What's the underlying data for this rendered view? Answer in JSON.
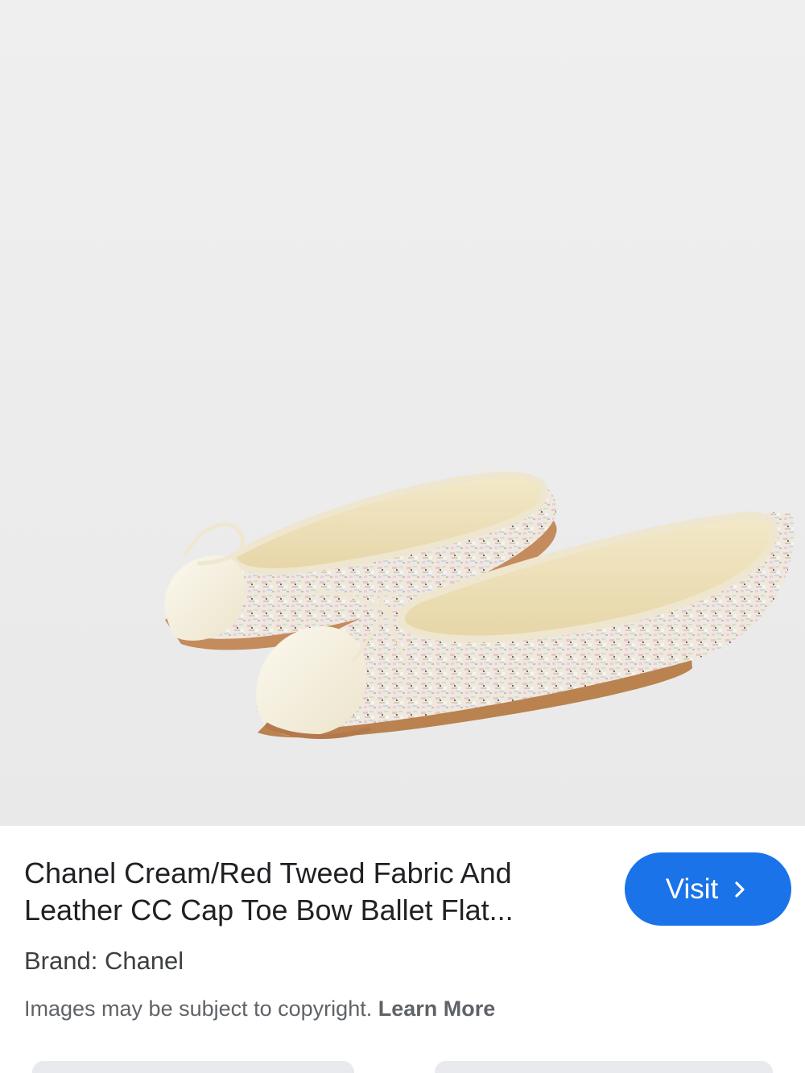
{
  "product": {
    "title": "Chanel Cream/Red Tweed Fabric And Leather CC Cap Toe Bow Ballet Flat...",
    "brand": "Brand: Chanel"
  },
  "actions": {
    "visit_label": "Visit"
  },
  "notice": {
    "text": "Images may be subject to copyright.",
    "link": "Learn More"
  },
  "image": {
    "description_icon": "product-photo-ballet-flats"
  },
  "colors": {
    "accent": "#1a73e8",
    "text_primary": "#202124",
    "text_secondary": "#5f6368"
  }
}
